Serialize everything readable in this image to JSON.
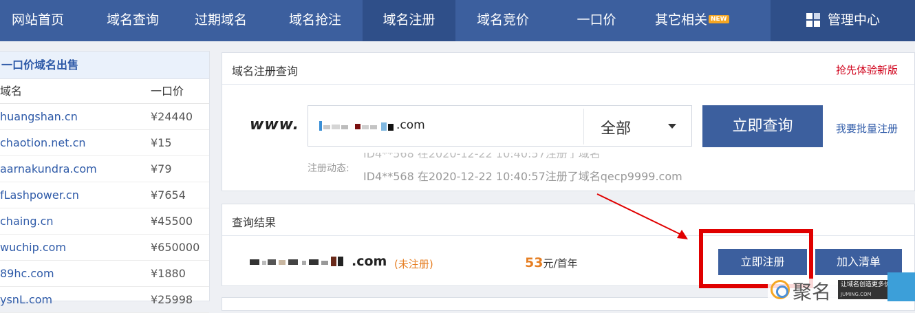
{
  "nav": {
    "items": [
      {
        "label": "网站首页"
      },
      {
        "label": "域名查询"
      },
      {
        "label": "过期域名"
      },
      {
        "label": "域名抢注"
      },
      {
        "label": "域名注册"
      },
      {
        "label": "域名竞价"
      },
      {
        "label": "一口价"
      },
      {
        "label": "其它相关"
      }
    ],
    "new_badge": "NEW",
    "management": "管理中心",
    "active": "域名注册"
  },
  "sidebar": {
    "title": "一口价域名出售",
    "col_domain": "域名",
    "col_price": "一口价",
    "rows": [
      {
        "domain": "huangshan.cn",
        "price": "¥24440"
      },
      {
        "domain": "chaotion.net.cn",
        "price": "¥15"
      },
      {
        "domain": "aarnakundra.com",
        "price": "¥79"
      },
      {
        "domain": "fLashpower.cn",
        "price": "¥7654"
      },
      {
        "domain": "chaing.cn",
        "price": "¥45500"
      },
      {
        "domain": "wuchip.com",
        "price": "¥650000"
      },
      {
        "domain": "89hc.com",
        "price": "¥1880"
      },
      {
        "domain": "ysnL.com",
        "price": "¥25998"
      }
    ]
  },
  "register": {
    "title": "域名注册查询",
    "try_new": "抢先体验新版",
    "www_prefix": "www.",
    "search_value": ".com",
    "scope_select": "全部",
    "query_button": "立即查询",
    "batch_link": "我要批量注册",
    "dynamics_label": "注册动态:",
    "dynamics_text": "ID4**568 在2020-12-22 10:40:57注册了域名qecp9999.com"
  },
  "result": {
    "title": "查询结果",
    "domain_suffix": ".com",
    "status": "(未注册)",
    "price_value": "53",
    "price_unit": "元/首年",
    "register_button": "立即注册",
    "add_button": "加入清单"
  },
  "watermark": {
    "brand": "聚名",
    "slogan": "让域名创造更多价值!",
    "site": "JUMING.COM"
  },
  "colors": {
    "nav_bg": "#3c5f9e",
    "accent_button": "#3c5f9e",
    "highlight_red": "#e00000",
    "status_orange": "#e67e22"
  }
}
